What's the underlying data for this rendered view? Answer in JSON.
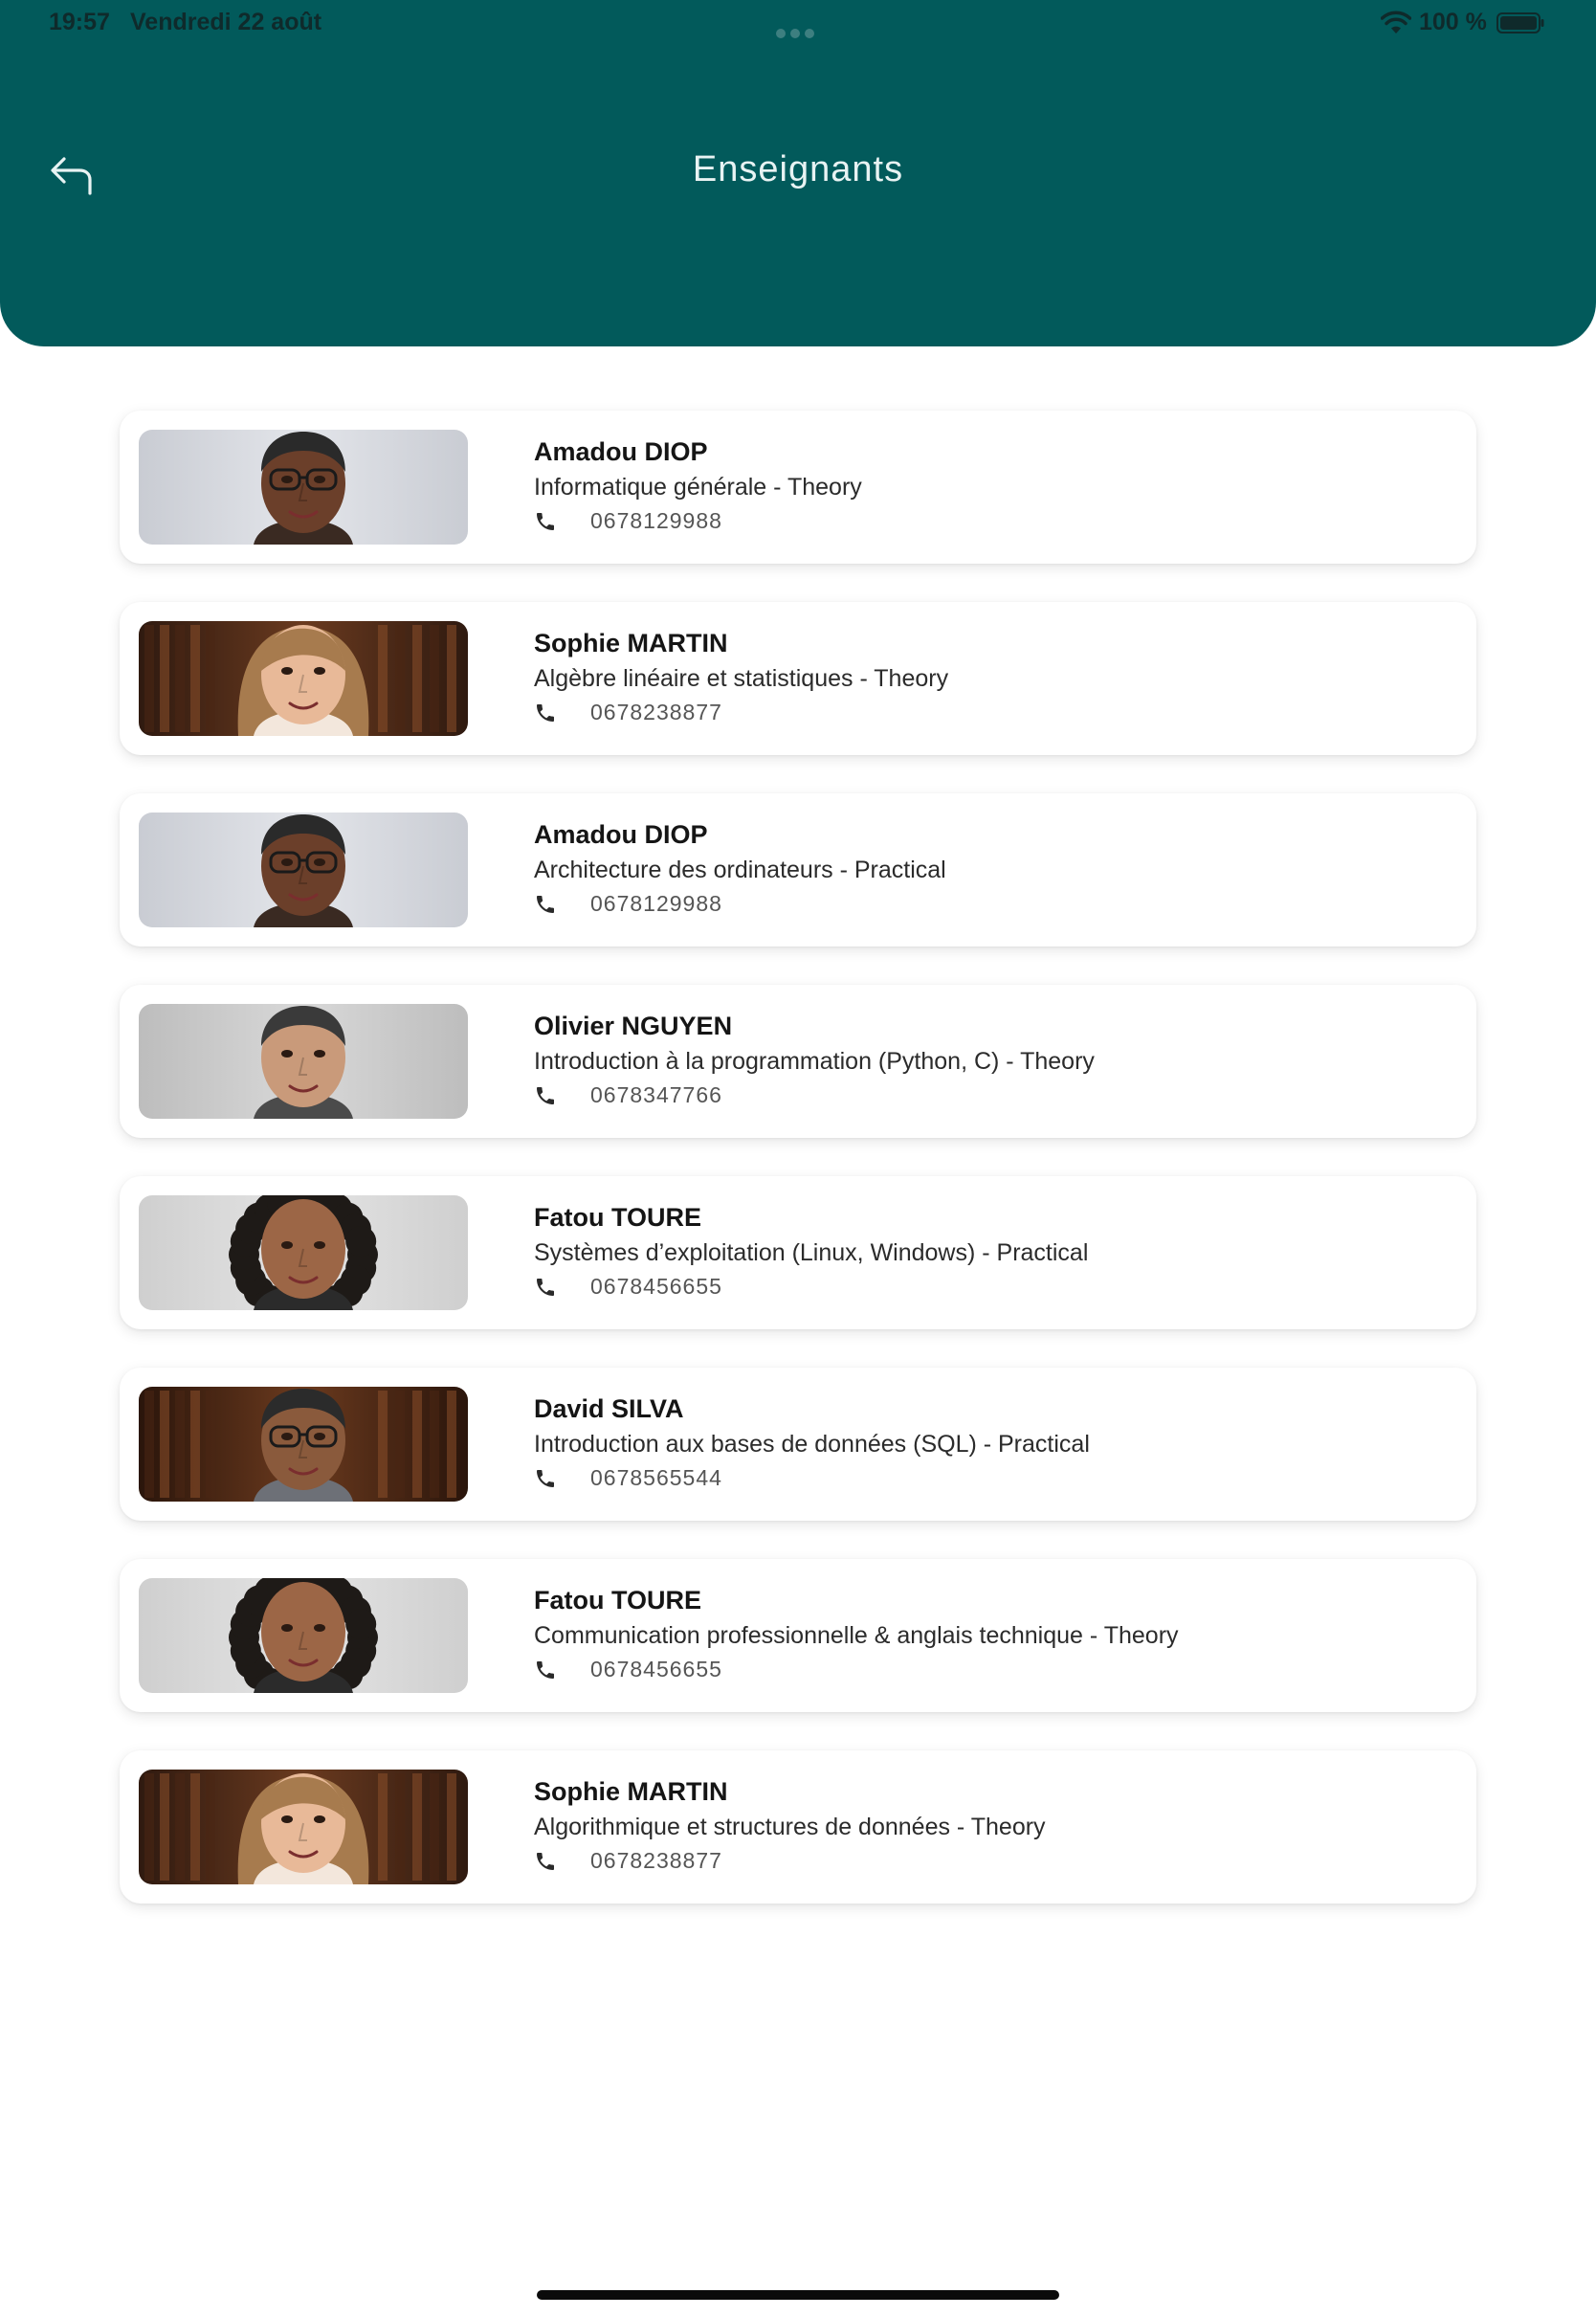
{
  "status_bar": {
    "time": "19:57",
    "date": "Vendredi 22 août",
    "battery": "100 %"
  },
  "header": {
    "title": "Enseignants",
    "background_color": "#025a5b"
  },
  "teachers": [
    {
      "name": "Amadou DIOP",
      "course": "Informatique générale - Theory",
      "phone": "0678129988",
      "photo": "portrait-man-glasses-grey-bg"
    },
    {
      "name": "Sophie MARTIN",
      "course": "Algèbre linéaire et statistiques - Theory",
      "phone": "0678238877",
      "photo": "portrait-woman-library-bg"
    },
    {
      "name": "Amadou DIOP",
      "course": "Architecture des ordinateurs - Practical",
      "phone": "0678129988",
      "photo": "portrait-man-glasses-grey-bg"
    },
    {
      "name": "Olivier NGUYEN",
      "course": "Introduction à la programmation (Python, C) - Theory",
      "phone": "0678347766",
      "photo": "portrait-man-grey-bg"
    },
    {
      "name": "Fatou TOURE",
      "course": "Systèmes d’exploitation (Linux, Windows) - Practical",
      "phone": "0678456655",
      "photo": "portrait-woman-curly-hair-grey-bg"
    },
    {
      "name": "David SILVA",
      "course": "Introduction aux bases de données (SQL) - Practical",
      "phone": "0678565544",
      "photo": "portrait-man-glasses-library-bg"
    },
    {
      "name": "Fatou TOURE",
      "course": "Communication professionnelle & anglais technique - Theory",
      "phone": "0678456655",
      "photo": "portrait-woman-curly-hair-grey-bg"
    },
    {
      "name": "Sophie MARTIN",
      "course": "Algorithmique et structures de données - Theory",
      "phone": "0678238877",
      "photo": "portrait-woman-library-bg"
    }
  ]
}
